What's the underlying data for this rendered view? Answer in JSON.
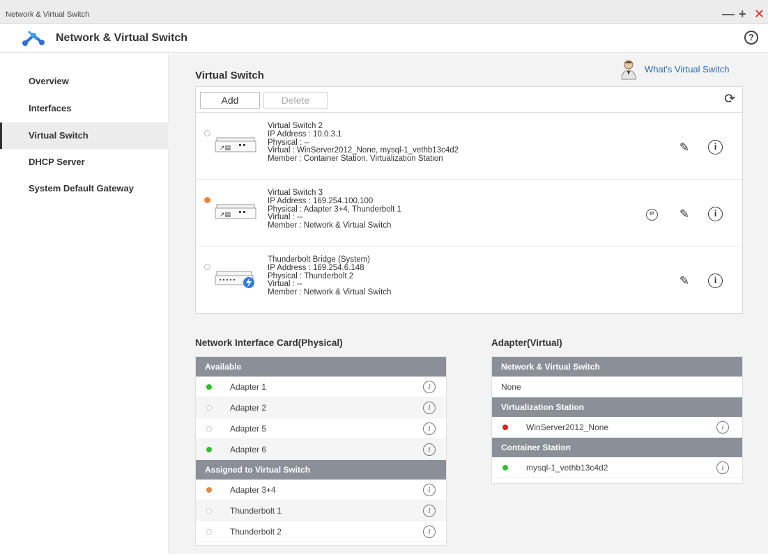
{
  "window": {
    "title": "Network & Virtual Switch",
    "controls": [
      "—",
      "+",
      "✕"
    ]
  },
  "app": {
    "title": "Network & Virtual Switch",
    "help": "?"
  },
  "sidebar": {
    "items": [
      {
        "label": "Overview"
      },
      {
        "label": "Interfaces"
      },
      {
        "label": "Virtual Switch",
        "active": true
      },
      {
        "label": "DHCP Server"
      },
      {
        "label": "System Default Gateway"
      }
    ]
  },
  "main": {
    "title": "Virtual Switch",
    "help_link": "What's Virtual Switch",
    "toolbar": {
      "add": "Add",
      "delete": "Delete"
    },
    "switches": [
      {
        "selected": false,
        "name": "Virtual Switch 2",
        "ip": "IP Address : 10.0.3.1",
        "physical": "Physical : --",
        "virtual": "Virtual : WinServer2012_None, mysql-1_vethb13c4d2",
        "member": "Member : Container Station, Virtualization Station",
        "icons": [
          "edit-icon",
          "info-icon"
        ]
      },
      {
        "selected": true,
        "name": "Virtual Switch 3",
        "ip": "IP Address : 169.254.100.100",
        "physical": "Physical : Adapter 3+4, Thunderbolt 1",
        "virtual": "Virtual : --",
        "member": "Member : Network & Virtual Switch",
        "icons": [
          "ip-icon",
          "edit-icon",
          "info-icon"
        ]
      },
      {
        "selected": false,
        "name": "Thunderbolt Bridge (System)",
        "ip": "IP Address : 169.254.6.148",
        "physical": "Physical : Thunderbolt 2",
        "virtual": "Virtual : --",
        "member": "Member : Network & Virtual Switch",
        "icons": [
          "edit-icon",
          "info-icon"
        ]
      }
    ]
  },
  "nic": {
    "title": "Network Interface Card(Physical)",
    "available_header": "Available",
    "available": [
      {
        "label": "Adapter 1",
        "status": "green"
      },
      {
        "label": "Adapter 2",
        "status": "empty"
      },
      {
        "label": "Adapter 5",
        "status": "empty"
      },
      {
        "label": "Adapter 6",
        "status": "green"
      }
    ],
    "assigned_header": "Assigned to Virtual Switch",
    "assigned": [
      {
        "label": "Adapter 3+4",
        "status": "orange"
      },
      {
        "label": "Thunderbolt 1",
        "status": "empty"
      },
      {
        "label": "Thunderbolt 2",
        "status": "empty"
      }
    ]
  },
  "adapter": {
    "title": "Adapter(Virtual)",
    "nvs_header": "Network & Virtual Switch",
    "nvs_value": "None",
    "vs_header": "Virtualization Station",
    "vs_item": {
      "label": "WinServer2012_None",
      "status": "red"
    },
    "cs_header": "Container Station",
    "cs_item": {
      "label": "mysql-1_vethb13c4d2",
      "status": "green"
    }
  },
  "colors": {
    "active_dot": "#2ec02e",
    "assigned_dot": "#e8893a",
    "error_dot": "#e02020",
    "table_header": "#8a8f98",
    "link": "#2b6cb0"
  }
}
